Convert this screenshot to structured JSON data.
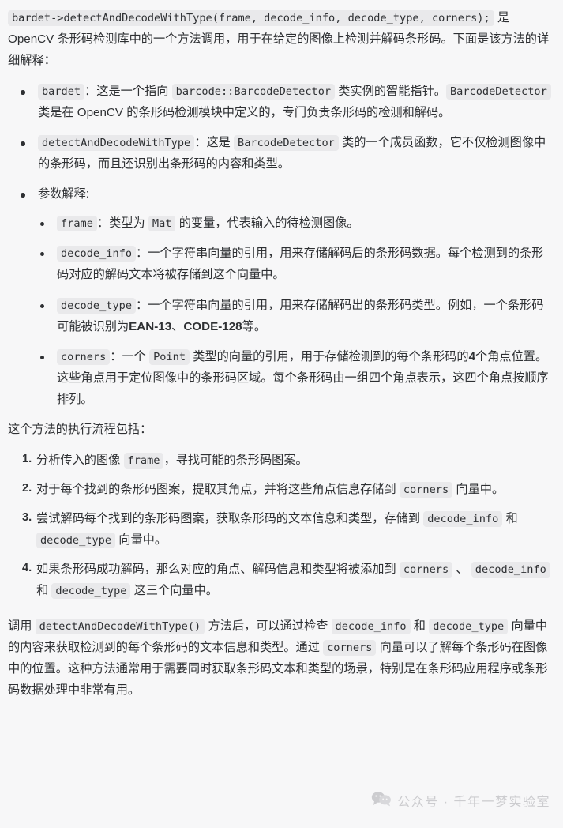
{
  "document": {
    "intro": {
      "code_signature": "bardet->detectAndDecodeWithType(frame, decode_info, decode_type, corners);",
      "text": " 是 OpenCV 条形码检测库中的一个方法调用，用于在给定的图像上检测并解码条形码。下面是该方法的详细解释："
    },
    "bullets": [
      {
        "code": "bardet",
        "text_1": "：这是一个指向 ",
        "code_2": "barcode::BarcodeDetector",
        "text_2": " 类实例的智能指针。",
        "code_3": "BarcodeDetector",
        "text_3": " 类是在 OpenCV 的条形码检测模块中定义的，专门负责条形码的检测和解码。"
      },
      {
        "code": "detectAndDecodeWithType",
        "text_1": "：这是 ",
        "code_2": "BarcodeDetector",
        "text_2": " 类的一个成员函数，它不仅检测图像中的条形码，而且还识别出条形码的内容和类型。"
      },
      {
        "label": "参数解释:"
      }
    ],
    "params": [
      {
        "code": "frame",
        "text_1": "：类型为 ",
        "code_2": "Mat",
        "text_2": " 的变量，代表输入的待检测图像。"
      },
      {
        "code": "decode_info",
        "text_1": "：一个字符串向量的引用，用来存储解码后的条形码数据。每个检测到的条形码对应的解码文本将被存储到这个向量中。"
      },
      {
        "code": "decode_type",
        "text_1": "：一个字符串向量的引用，用来存储解码出的条形码类型。例如，一个条形码可能被识别为",
        "bold_1": "EAN-13",
        "text_2": "、",
        "bold_2": "CODE-128",
        "text_3": "等。"
      },
      {
        "code": "corners",
        "text_1": "：一个 ",
        "code_2": "Point",
        "text_2": " 类型的向量的引用，用于存储检测到的每个条形码的",
        "bold_1": "4",
        "text_3": "个角点位置。这些角点用于定位图像中的条形码区域。每个条形码由一组四个角点表示，这四个角点按顺序排列。"
      }
    ],
    "flow_heading": "这个方法的执行流程包括：",
    "steps": [
      {
        "text_1": "分析传入的图像 ",
        "code_1": "frame",
        "text_2": "，寻找可能的条形码图案。"
      },
      {
        "text_1": "对于每个找到的条形码图案，提取其角点，并将这些角点信息存储到 ",
        "code_1": "corners",
        "text_2": " 向量中。"
      },
      {
        "text_1": "尝试解码每个找到的条形码图案，获取条形码的文本信息和类型，存储到 ",
        "code_1": "decode_info",
        "text_2": " 和 ",
        "code_2": "decode_type",
        "text_3": " 向量中。"
      },
      {
        "text_1": "如果条形码成功解码，那么对应的角点、解码信息和类型将被添加到 ",
        "code_1": "corners",
        "text_2": " 、 ",
        "code_2": "decode_info",
        "text_3": " 和 ",
        "code_3": "decode_type",
        "text_4": " 这三个向量中。"
      }
    ],
    "conclusion": {
      "text_1": "调用 ",
      "code_1": "detectAndDecodeWithType()",
      "text_2": " 方法后，可以通过检查 ",
      "code_2": "decode_info",
      "text_3": " 和 ",
      "code_3": "decode_type",
      "text_4": " 向量中的内容来获取检测到的每个条形码的文本信息和类型。通过 ",
      "code_4": "corners",
      "text_5": " 向量可以了解每个条形码在图像中的位置。这种方法通常用于需要同时获取条形码文本和类型的场景，特别是在条形码应用程序或条形码数据处理中非常有用。"
    }
  },
  "watermark": {
    "icon": "wechat-bubbles-icon",
    "text": "公众号 · 千年一梦实验室",
    "color": "#c9c9cc"
  },
  "theme": {
    "page_background": "#f7f7f8",
    "text_color": "#2e3033",
    "inline_code_background": "#e9e9eb"
  }
}
